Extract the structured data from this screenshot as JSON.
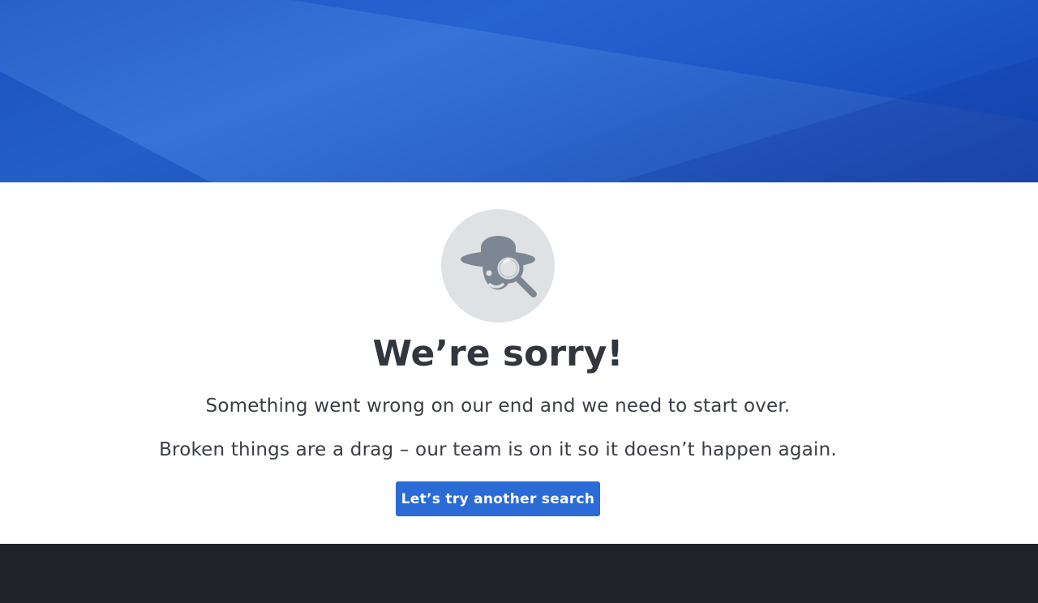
{
  "error_page": {
    "title": "We’re sorry!",
    "message_1": "Something went wrong on our end and we need to start over.",
    "message_2": "Broken things are a drag – our team is on it so it doesn’t happen again.",
    "cta_label": "Let’s try another search",
    "illustration_icon": "detective-magnifier-icon"
  },
  "colors": {
    "hero_blue": "#2a6bd6",
    "button_blue": "#2a6bd6",
    "avatar_bg": "#dfe2e5",
    "icon_gray": "#7d8793",
    "text_dark": "#32363d",
    "footer_dark": "#20232a"
  }
}
